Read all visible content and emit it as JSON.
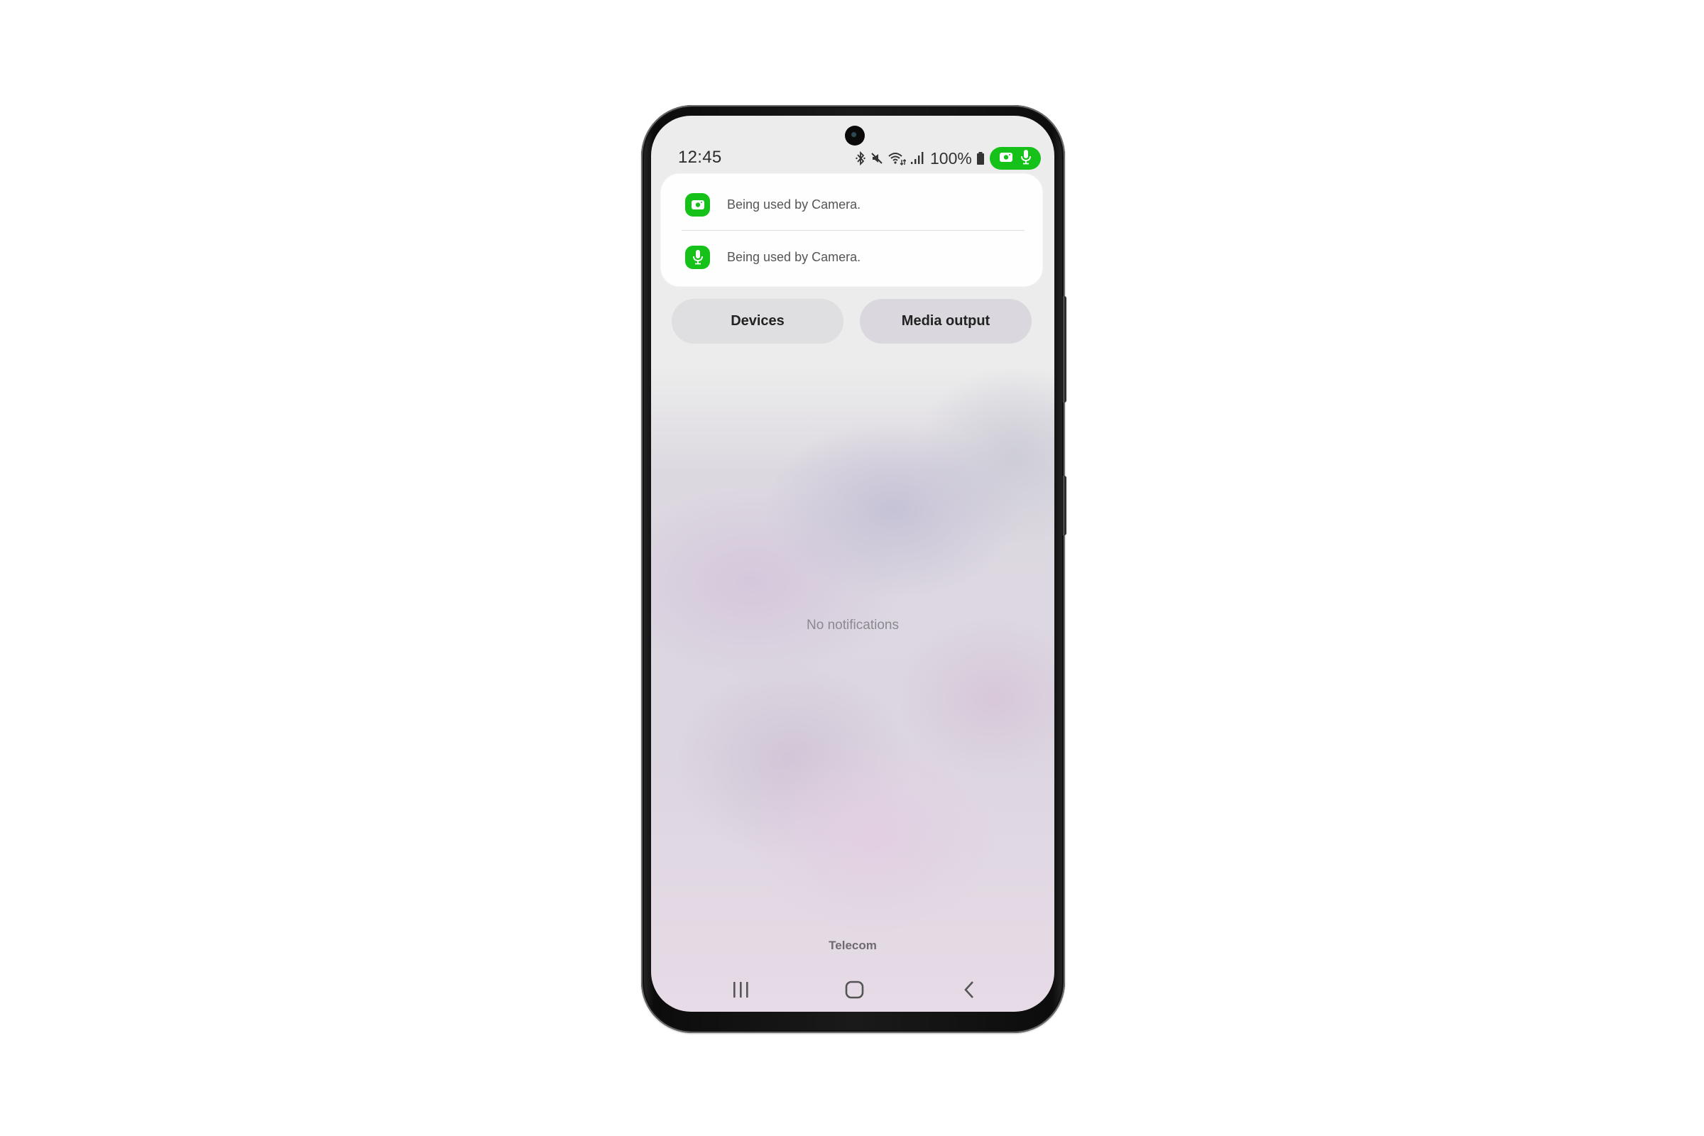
{
  "status_bar": {
    "time": "12:45",
    "battery_text": "100%",
    "icons": [
      "bluetooth-icon",
      "mute-icon",
      "wifi-icon",
      "signal-icon",
      "battery-icon"
    ],
    "privacy_indicator": {
      "icons": [
        "camera-icon",
        "microphone-icon"
      ],
      "color": "#16c21a"
    }
  },
  "privacy_card": {
    "items": [
      {
        "icon": "camera-icon",
        "text": "Being used by Camera."
      },
      {
        "icon": "microphone-icon",
        "text": "Being used by Camera."
      }
    ]
  },
  "quick_buttons": {
    "devices_label": "Devices",
    "media_output_label": "Media output"
  },
  "notifications": {
    "empty_text": "No notifications"
  },
  "carrier": "Telecom",
  "nav_bar": {
    "buttons": [
      "recents-icon",
      "home-icon",
      "back-icon"
    ]
  }
}
